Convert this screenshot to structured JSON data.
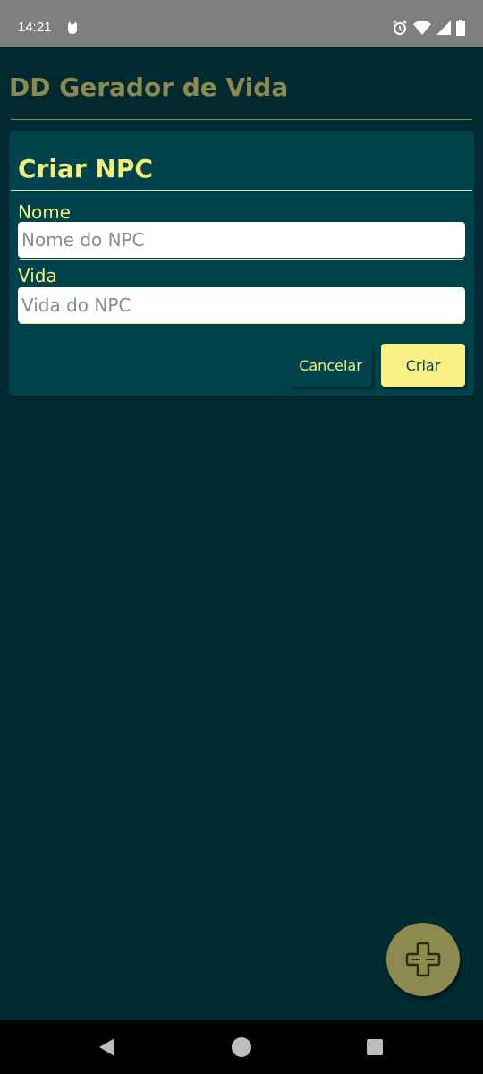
{
  "status_bar": {
    "time": "14:21",
    "left_icons": [
      "notification-app-icon"
    ],
    "right_icons": [
      "alarm-icon",
      "wifi-icon",
      "cellular-signal-icon",
      "battery-icon"
    ]
  },
  "app_bar": {
    "title": "DD Gerador de Vida"
  },
  "dialog": {
    "title": "Criar NPC",
    "fields": [
      {
        "label": "Nome",
        "value": "",
        "placeholder": "Nome do NPC"
      },
      {
        "label": "Vida",
        "value": "",
        "placeholder": "Vida do NPC"
      }
    ],
    "cancel_label": "Cancelar",
    "create_label": "Criar"
  },
  "fab": {
    "icon": "plus-cross-icon"
  },
  "nav_bar": {
    "icons": [
      "back-icon",
      "home-icon",
      "recents-icon"
    ]
  },
  "colors": {
    "background": "#022c34",
    "app_bar": "#012930",
    "dialog": "#01434d",
    "accent_yellow": "#f3ee7c",
    "button_yellow": "#faf186",
    "olive": "#8c8a4c",
    "status_bar": "#7f7f7f"
  }
}
